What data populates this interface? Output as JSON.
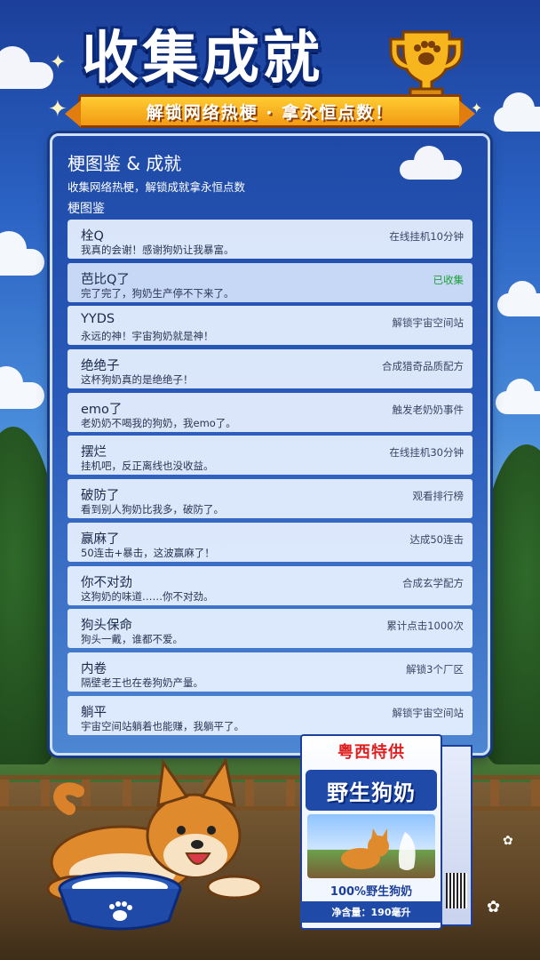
{
  "header": {
    "title": "收集成就",
    "subtitle": "解锁网络热梗 · 拿永恒点数！"
  },
  "panel": {
    "title": "梗图鉴 & 成就",
    "subtitle": "收集网络热梗，解锁成就拿永恒点数",
    "section_label": "梗图鉴"
  },
  "memes": [
    {
      "name": "栓Q",
      "desc": "我真的会谢！感谢狗奶让我暴富。",
      "condition": "在线挂机10分钟",
      "collected": false
    },
    {
      "name": "芭比Q了",
      "desc": "完了完了，狗奶生产停不下来了。",
      "condition": "已收集",
      "collected": true
    },
    {
      "name": "YYDS",
      "desc": "永远的神！宇宙狗奶就是神！",
      "condition": "解锁宇宙空间站",
      "collected": false
    },
    {
      "name": "绝绝子",
      "desc": "这杯狗奶真的是绝绝子！",
      "condition": "合成猎奇品质配方",
      "collected": false
    },
    {
      "name": "emo了",
      "desc": "老奶奶不喝我的狗奶，我emo了。",
      "condition": "触发老奶奶事件",
      "collected": false
    },
    {
      "name": "摆烂",
      "desc": "挂机吧，反正离线也没收益。",
      "condition": "在线挂机30分钟",
      "collected": false
    },
    {
      "name": "破防了",
      "desc": "看到别人狗奶比我多，破防了。",
      "condition": "观看排行榜",
      "collected": false
    },
    {
      "name": "赢麻了",
      "desc": "50连击+暴击，这波赢麻了！",
      "condition": "达成50连击",
      "collected": false
    },
    {
      "name": "你不对劲",
      "desc": "这狗奶的味道……你不对劲。",
      "condition": "合成玄学配方",
      "collected": false
    },
    {
      "name": "狗头保命",
      "desc": "狗头一戴，谁都不爱。",
      "condition": "累计点击1000次",
      "collected": false
    },
    {
      "name": "内卷",
      "desc": "隔壁老王也在卷狗奶产量。",
      "condition": "解锁3个厂区",
      "collected": false
    },
    {
      "name": "躺平",
      "desc": "宇宙空间站躺着也能赚，我躺平了。",
      "condition": "解锁宇宙空间站",
      "collected": false
    }
  ],
  "milk_box": {
    "brand": "粤西特供",
    "name": "野生狗奶",
    "percent_label": "100%野生狗奶",
    "volume": "净含量：190毫升"
  },
  "colors": {
    "collected": "#1ea33a",
    "panel_blue": "#1f4aa8",
    "ribbon_gold": "#f29a12"
  },
  "icons": [
    "trophy-icon",
    "paw-icon",
    "shiba-dog",
    "milk-bowl",
    "milk-carton"
  ]
}
